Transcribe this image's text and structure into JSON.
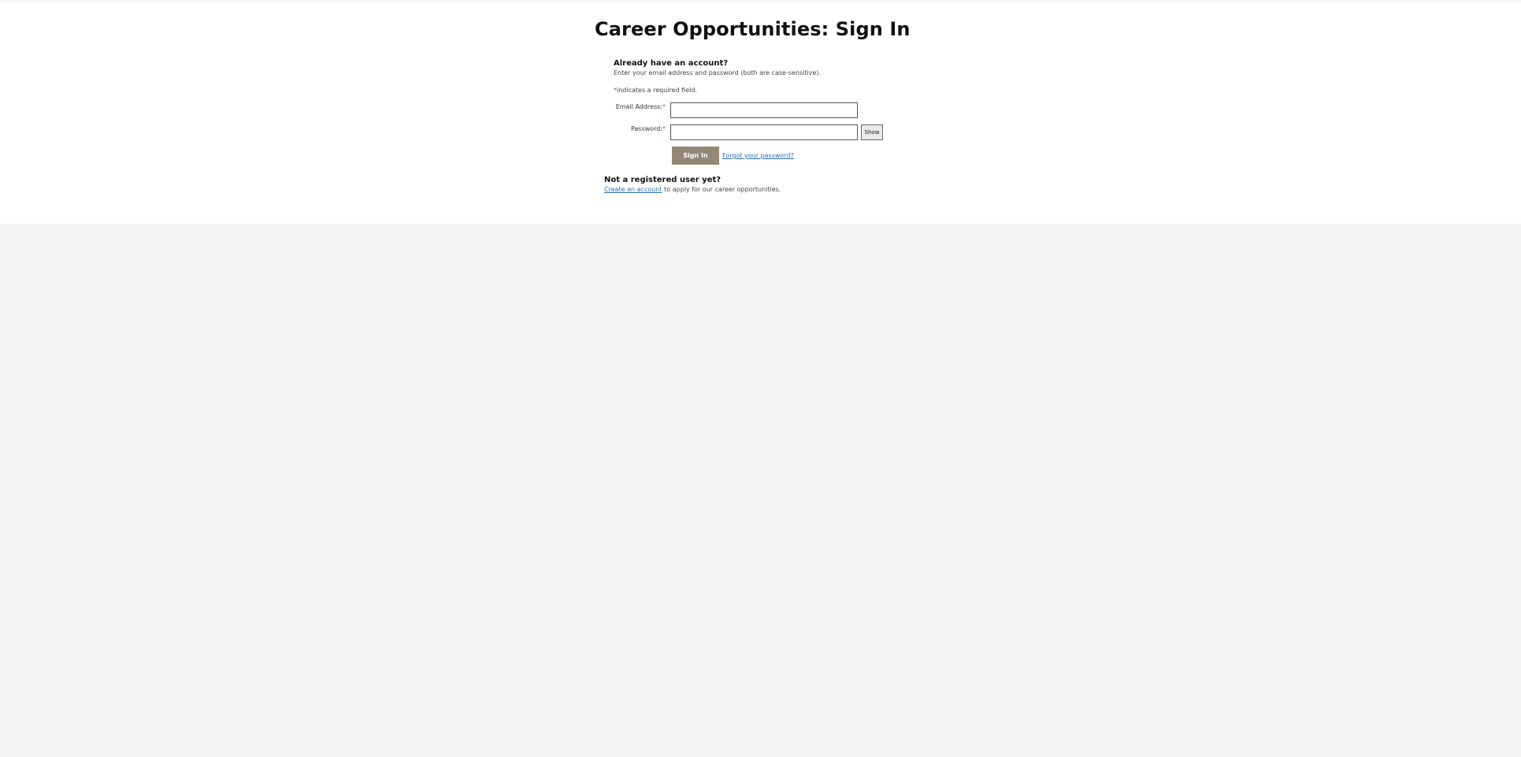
{
  "page": {
    "title": "Career Opportunities: Sign In"
  },
  "signin": {
    "heading": "Already have an account?",
    "instructions": "Enter your email address and password (both are case-sensitive).",
    "required_star": "*",
    "required_note": "indicates a required field.",
    "email_label": "Email Address:",
    "email_value": "",
    "password_label": "Password:",
    "password_value": "",
    "show_label": "Show",
    "submit_label": "Sign In",
    "forgot_label": "Forgot your password?"
  },
  "register": {
    "heading": "Not a registered user yet?",
    "link_label": "Create an account",
    "suffix": " to apply for our career opportunities."
  },
  "colors": {
    "background": "#f3f3f1",
    "panel": "#ffffff",
    "primary_button": "#958878",
    "link": "#2a6db5",
    "required_star": "#a06a00"
  }
}
